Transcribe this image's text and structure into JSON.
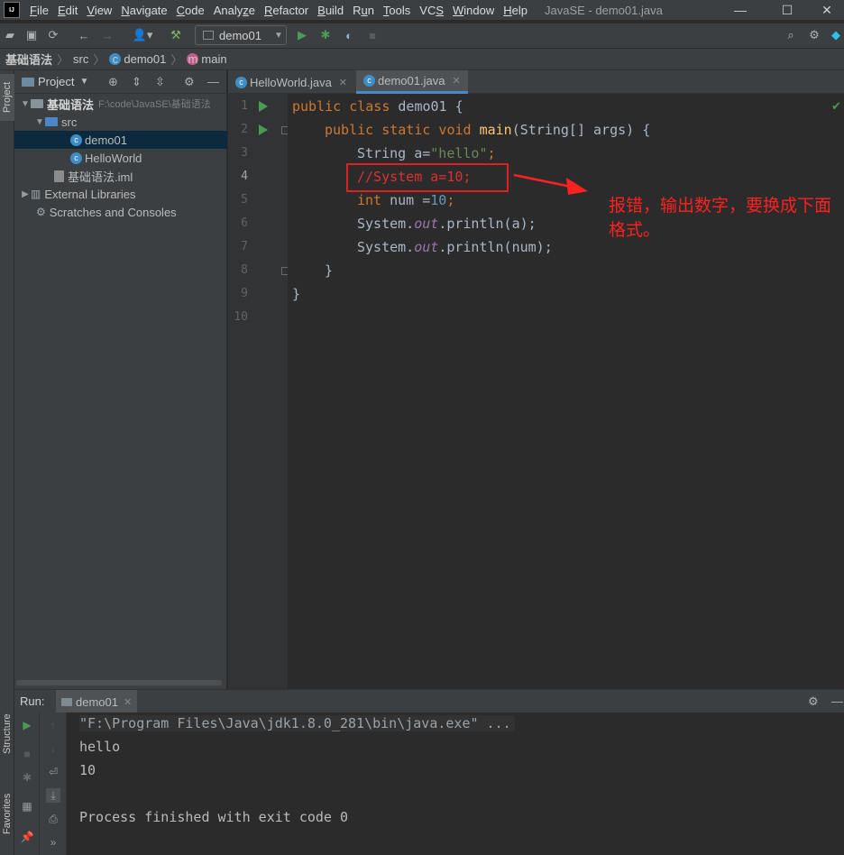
{
  "menubar": {
    "items": [
      "File",
      "Edit",
      "View",
      "Navigate",
      "Code",
      "Analyze",
      "Refactor",
      "Build",
      "Run",
      "Tools",
      "VCS",
      "Window",
      "Help"
    ],
    "mnemonics": [
      "F",
      "E",
      "V",
      "N",
      "C",
      "z",
      "R",
      "B",
      "u",
      "T",
      "S",
      "W",
      "H"
    ],
    "title": "JavaSE - demo01.java",
    "logo": "IJ"
  },
  "toolbar": {
    "run_config": "demo01"
  },
  "breadcrumb": {
    "items": [
      "基础语法",
      "src",
      "demo01",
      "main"
    ]
  },
  "left_strip": {
    "project_tab": "Project",
    "structure_tab": "Structure",
    "favorites_tab": "Favorites"
  },
  "project": {
    "header": "Project",
    "tree": [
      {
        "label": "基础语法",
        "path": "F:\\code\\JavaSE\\基础语法"
      },
      {
        "label": "src"
      },
      {
        "label": "demo01"
      },
      {
        "label": "HelloWorld"
      },
      {
        "label": "基础语法.iml"
      },
      {
        "label": "External Libraries"
      },
      {
        "label": "Scratches and Consoles"
      }
    ]
  },
  "editor": {
    "tabs": [
      "HelloWorld.java",
      "demo01.java"
    ],
    "active_tab": "demo01.java",
    "line_numbers": [
      "1",
      "2",
      "3",
      "4",
      "5",
      "6",
      "7",
      "8",
      "9",
      "10"
    ],
    "code": {
      "l1": {
        "kw": "public class ",
        "rest": "demo01 {"
      },
      "l2": {
        "kw1": "public static void ",
        "fn": "main",
        "rest": "(String[] args) {"
      },
      "l3": {
        "pre": "String a=",
        "str": "\"hello\"",
        "post": ";"
      },
      "l4": {
        "comment": "//System a=10;"
      },
      "l5": {
        "kw": "int ",
        "mid": "num =",
        "num": "10",
        "post": ";"
      },
      "l6": {
        "pre": "System.",
        "fld": "out",
        "post": ".println(a);"
      },
      "l7": {
        "pre": "System.",
        "fld": "out",
        "post": ".println(num);"
      },
      "l8": "}",
      "l9": "}"
    },
    "annotation": "报错，输出数字，要换成下面格式。"
  },
  "run": {
    "label": "Run:",
    "tab": "demo01",
    "console": [
      "\"F:\\Program Files\\Java\\jdk1.8.0_281\\bin\\java.exe\" ...",
      "hello",
      "10",
      "",
      "Process finished with exit code 0"
    ]
  },
  "colors": {
    "keyword": "#cc7832",
    "string": "#6a8759",
    "number": "#6897bb",
    "error_comment": "#e03030",
    "annotation": "#ff2020",
    "selection": "#0d293e"
  }
}
